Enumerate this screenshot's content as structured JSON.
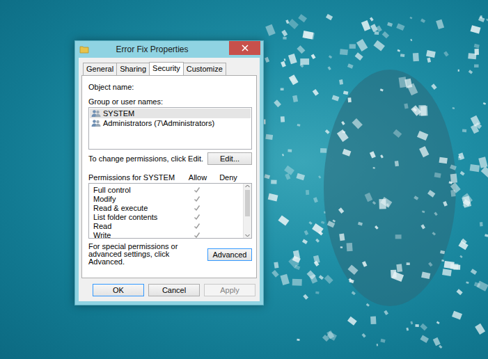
{
  "window": {
    "title": "Error Fix Properties"
  },
  "tabs": [
    {
      "label": "General",
      "selected": false
    },
    {
      "label": "Sharing",
      "selected": false
    },
    {
      "label": "Security",
      "selected": true
    },
    {
      "label": "Customize",
      "selected": false
    }
  ],
  "object_name_label": "Object name:",
  "users_label": "Group or user names:",
  "users": [
    {
      "name": "SYSTEM",
      "selected": true
    },
    {
      "name": "Administrators (7\\Administrators)",
      "selected": false
    }
  ],
  "edit_hint": "To change permissions, click Edit.",
  "edit_button": "Edit...",
  "permissions": {
    "header": "Permissions for SYSTEM",
    "columns": [
      "Allow",
      "Deny"
    ],
    "rows": [
      {
        "name": "Full control",
        "allow": true,
        "deny": false
      },
      {
        "name": "Modify",
        "allow": true,
        "deny": false
      },
      {
        "name": "Read & execute",
        "allow": true,
        "deny": false
      },
      {
        "name": "List folder contents",
        "allow": true,
        "deny": false
      },
      {
        "name": "Read",
        "allow": true,
        "deny": false
      },
      {
        "name": "Write",
        "allow": true,
        "deny": false
      }
    ]
  },
  "advanced_hint": "For special permissions or advanced settings, click Advanced.",
  "advanced_button": "Advanced",
  "buttons": [
    {
      "label": "OK",
      "disabled": false
    },
    {
      "label": "Cancel",
      "disabled": false
    },
    {
      "label": "Apply",
      "disabled": true
    }
  ]
}
